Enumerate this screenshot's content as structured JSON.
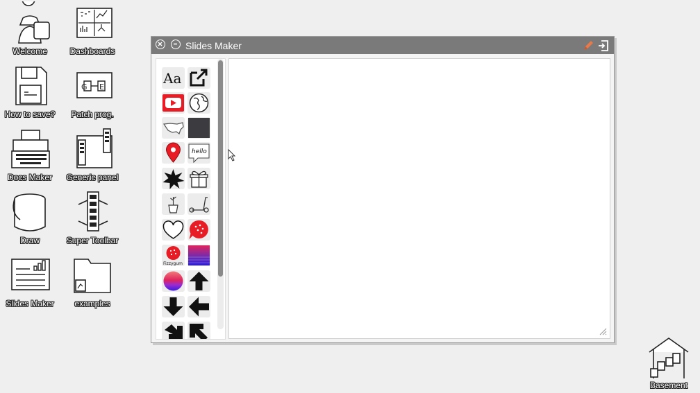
{
  "desktop": {
    "icons": [
      {
        "label": "Welcome",
        "icon": "welcome-figure-icon"
      },
      {
        "label": "Dashboards",
        "icon": "dashboard-icon"
      },
      {
        "label": "How to save?",
        "icon": "floppy-disk-icon"
      },
      {
        "label": "Patch prog.",
        "icon": "patch-icon"
      },
      {
        "label": "Docs Maker",
        "icon": "typewriter-icon"
      },
      {
        "label": "Generic panel",
        "icon": "panel-icon"
      },
      {
        "label": "Draw",
        "icon": "paint-bucket-icon"
      },
      {
        "label": "Super Toolbar",
        "icon": "toolbar-icon"
      },
      {
        "label": "Slides Maker",
        "icon": "slides-icon"
      },
      {
        "label": "examples",
        "icon": "folder-icon"
      },
      {
        "label": "Basement",
        "icon": "basement-icon"
      }
    ]
  },
  "window": {
    "title": "Slides Maker",
    "sidebar": {
      "tiles": [
        {
          "icon": "text-icon",
          "text": "Aa"
        },
        {
          "icon": "external-link-icon"
        },
        {
          "icon": "youtube-icon"
        },
        {
          "icon": "globe-icon"
        },
        {
          "icon": "usa-map-icon"
        },
        {
          "icon": "dark-square-icon"
        },
        {
          "icon": "map-pin-icon"
        },
        {
          "icon": "speech-bubble-icon",
          "text": "hello"
        },
        {
          "icon": "starburst-icon"
        },
        {
          "icon": "gift-box-icon"
        },
        {
          "icon": "plant-pot-icon"
        },
        {
          "icon": "scooter-icon"
        },
        {
          "icon": "heart-icon"
        },
        {
          "icon": "fizzygum-bubble-icon"
        },
        {
          "icon": "fizzygum-logo-icon",
          "text": "Fizzygum"
        },
        {
          "icon": "gradient-square-icon"
        },
        {
          "icon": "gradient-circle-icon"
        },
        {
          "icon": "arrow-up-icon"
        },
        {
          "icon": "arrow-down-icon"
        },
        {
          "icon": "arrow-left-icon"
        },
        {
          "icon": "arrow-down-right-icon"
        },
        {
          "icon": "arrow-up-left-icon"
        }
      ]
    }
  },
  "colors": {
    "titlebar": "#7a7a7a",
    "desktop": "#efefef",
    "youtube_red": "#e81c24",
    "pencil_orange": "#e8794a"
  }
}
